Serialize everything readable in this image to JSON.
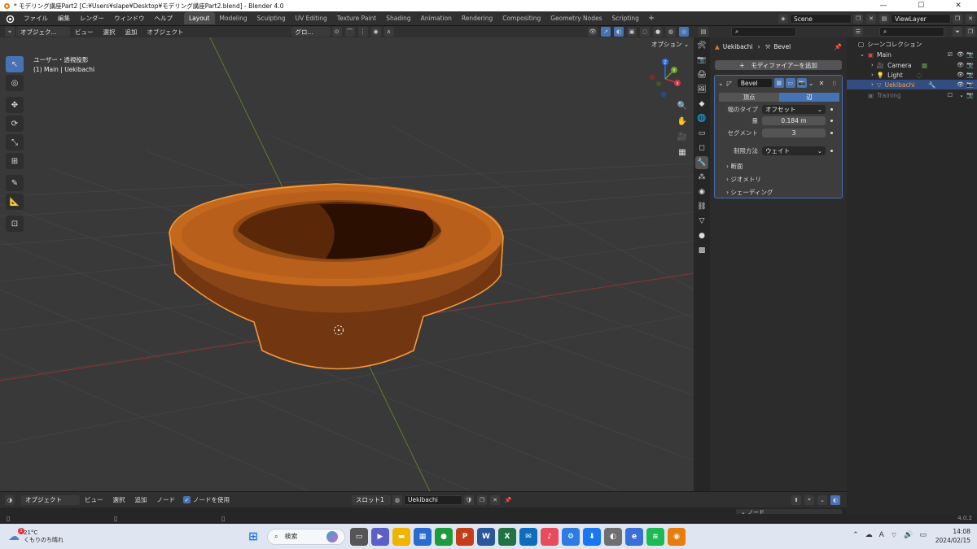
{
  "titlebar": {
    "title": "* モデリング講座Part2 [C:¥Users¥slape¥Desktop¥モデリング講座Part2.blend] - Blender 4.0",
    "min": "—",
    "max": "☐",
    "close": "✕"
  },
  "menu": [
    "ファイル",
    "編集",
    "レンダー",
    "ウィンドウ",
    "ヘルプ"
  ],
  "workspaces": [
    "Layout",
    "Modeling",
    "Sculpting",
    "UV Editing",
    "Texture Paint",
    "Shading",
    "Animation",
    "Rendering",
    "Compositing",
    "Geometry Nodes",
    "Scripting"
  ],
  "active_workspace": "Layout",
  "scene": "Scene",
  "view_layer": "ViewLayer",
  "viewport_header": {
    "mode": "オブジェク...",
    "items": [
      "ビュー",
      "選択",
      "追加",
      "オブジェクト"
    ],
    "orientation": "グロ..."
  },
  "viewport": {
    "options_label": "オプション",
    "view_name": "ユーザー・透視投影",
    "collection_info": "(1) Main | Uekibachi",
    "gizmo": {
      "x": "X",
      "y": "Y",
      "z": "Z"
    }
  },
  "properties": {
    "object_name": "Uekibachi",
    "modifier_crumb": "Bevel",
    "add_modifier": "モディファイアーを追加",
    "modifier": {
      "name": "Bevel",
      "tabs": [
        "頂点",
        "辺"
      ],
      "active_tab": "辺",
      "width_type_label": "幅のタイプ",
      "width_type": "オフセット",
      "amount_label": "量",
      "amount": "0.184 m",
      "segments_label": "セグメント",
      "segments": "3",
      "limit_label": "制限方法",
      "limit": "ウェイト",
      "subpanels": [
        "断面",
        "ジオメトリ",
        "シェーディング"
      ]
    }
  },
  "outliner": {
    "scene_collection": "シーンコレクション",
    "rows": [
      {
        "name": "Main",
        "selected": false
      },
      {
        "name": "Camera",
        "selected": false
      },
      {
        "name": "Light",
        "selected": false
      },
      {
        "name": "Uekibachi",
        "selected": true
      },
      {
        "name": "Training",
        "selected": false
      }
    ]
  },
  "shader_header": {
    "mode": "オブジェクト",
    "items": [
      "ビュー",
      "選択",
      "追加",
      "ノード"
    ],
    "use_nodes": "ノードを使用",
    "slot": "スロット1",
    "material": "Uekibachi"
  },
  "timeline": {
    "node_label": "ノード"
  },
  "version": "4.0.2",
  "taskbar": {
    "weather_temp": "21°C",
    "weather_desc": "くもりのち晴れ",
    "search": "検索",
    "time": "14:08",
    "date": "2024/02/15",
    "ime": "A",
    "badge": "1"
  },
  "colors": {
    "accent": "#4772b3",
    "object": "#c4681e",
    "selection": "#f39a3b"
  }
}
